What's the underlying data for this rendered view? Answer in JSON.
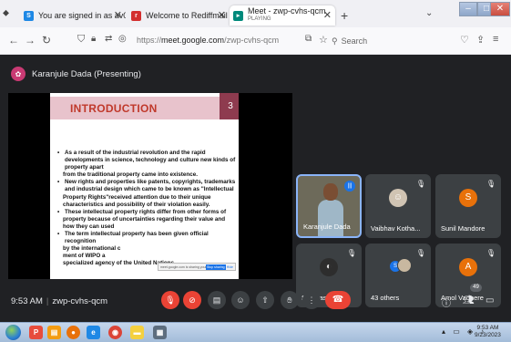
{
  "browser": {
    "tabs": [
      {
        "title": "You are signed in as av072010",
        "favicon": "S",
        "close": "✕"
      },
      {
        "title": "Welcome to Rediffmail",
        "favicon": "r",
        "close": "✕"
      },
      {
        "title": "Meet - zwp-cvhs-qcm",
        "subtitle": "PLAYING",
        "close": "✕",
        "active": true
      }
    ],
    "new_tab": "+",
    "tab_menu": "⌄",
    "url_prefix": "https://",
    "url_domain": "meet.google.com",
    "url_path": "/zwp-cvhs-qcm",
    "search_placeholder": "Search",
    "accent": "#1a73e8"
  },
  "meet": {
    "presenter_label": "Karanjule Dada (Presenting)",
    "slide": {
      "title": "INTRODUCTION",
      "number": "3",
      "paragraphs": [
        {
          "bullet": true,
          "text": "As a result of the industrial revolution and the rapid developments in science, technology and culture new kinds of property apart"
        },
        {
          "bullet": false,
          "text": "from the traditional property came into existence."
        },
        {
          "bullet": true,
          "text": "New rights and properties like patents, copyrights, trademarks and industrial design which came to be known as \"Intellectual"
        },
        {
          "bullet": false,
          "text": "Property Rights\"received attention due to their unique"
        },
        {
          "bullet": false,
          "text": "characteristics and possibility of their violation easily."
        },
        {
          "bullet": true,
          "text": "These intellectual property rights differ from other forms of"
        },
        {
          "bullet": false,
          "text": "property because of uncertainties regarding their value and"
        },
        {
          "bullet": false,
          "text": "how they can used"
        },
        {
          "bullet": true,
          "text": "The term intellectual property has been given official recognition"
        },
        {
          "bullet": false,
          "text": "by the international c"
        },
        {
          "bullet": false,
          "text": "ment of WIPO a"
        },
        {
          "bullet": false,
          "text": "specialized agency of the United Nations."
        }
      ],
      "share_popup": {
        "text": "meet.google.com is sharing your screen",
        "stop": "Stop sharing",
        "hide": "Hide"
      }
    },
    "participants": [
      {
        "name": "Karanjule Dada",
        "kind": "video",
        "speaking": true
      },
      {
        "name": "Vaibhav Kotha...",
        "kind": "photo",
        "muted": true
      },
      {
        "name": "Sunil Mandore",
        "kind": "initial",
        "initial": "S",
        "color": "#e8710a",
        "muted": true
      },
      {
        "name": "Shreyash more",
        "kind": "photo",
        "muted": true
      },
      {
        "name": "43 others",
        "kind": "others",
        "initial": "S",
        "muted": true
      },
      {
        "name": "Amol Vadnere",
        "kind": "initial",
        "initial": "A",
        "color": "#e8710a",
        "muted": true
      }
    ],
    "time": "9:53 AM",
    "meeting_code": "zwp-cvhs-qcm",
    "participant_count": "49"
  },
  "taskbar": {
    "time": "9:53 AM",
    "date": "9/23/2023"
  }
}
